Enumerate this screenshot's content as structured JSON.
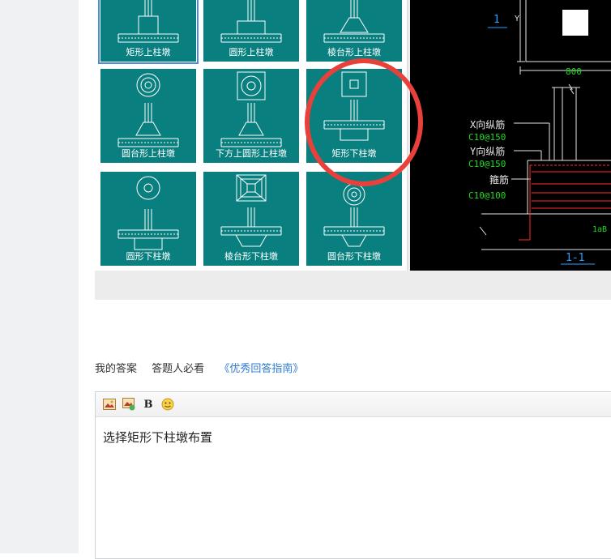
{
  "grid_items": [
    {
      "label": "矩形上柱墩",
      "selected": true
    },
    {
      "label": "圆形上柱墩"
    },
    {
      "label": "棱台形上柱墩"
    },
    {
      "label": "圆台形上柱墩"
    },
    {
      "label": "下方上圆形上柱墩"
    },
    {
      "label": "矩形下柱墩"
    },
    {
      "label": "圆形下柱墩"
    },
    {
      "label": "棱台形下柱墩"
    },
    {
      "label": "圆台形下柱墩"
    }
  ],
  "cad": {
    "label_1": "1",
    "label_y": "Y",
    "dim_800": "800",
    "x_rebar": "X向纵筋",
    "x_rebar_spec": "C10@150",
    "y_rebar": "Y向纵筋",
    "y_rebar_spec": "C10@150",
    "stirrup": "箍筋",
    "stirrup_spec": "C10@100",
    "lab": "1aB",
    "section": "1-1"
  },
  "answer_row": {
    "my_answer": "我的答案",
    "must_read": "答题人必看",
    "guide_link": "《优秀回答指南》"
  },
  "editor": {
    "content": "选择矩形下柱墩布置",
    "bold_label": "B"
  },
  "colors": {
    "teal": "#0a7f7f",
    "annotation_red": "#e8403a",
    "link_blue": "#2e7bcf",
    "cad_green": "#22d822"
  }
}
